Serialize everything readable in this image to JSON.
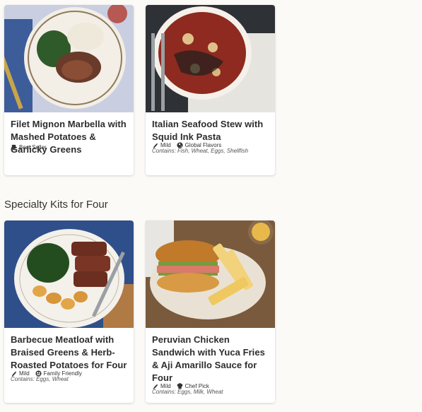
{
  "cards_top": [
    {
      "title": "Filet Mignon Marbella with Mashed Potatoes & Garlicky Greens",
      "contains": "",
      "tags": [
        {
          "icon": "badge-icon",
          "label": "Best Seller"
        }
      ]
    },
    {
      "title": "Italian Seafood Stew with Squid Ink Pasta",
      "contains": "Contains: Fish, Wheat, Eggs, Shellfish",
      "tags": [
        {
          "icon": "pepper-icon",
          "label": "Mild"
        },
        {
          "icon": "globe-icon",
          "label": "Global Flavors"
        }
      ]
    }
  ],
  "section": {
    "title": "Specialty Kits for Four"
  },
  "cards_bottom": [
    {
      "title": "Barbecue Meatloaf with Braised Greens & Herb-Roasted Potatoes for Four",
      "contains": "Contains: Eggs, Wheat",
      "tags": [
        {
          "icon": "pepper-icon",
          "label": "Mild"
        },
        {
          "icon": "family-icon",
          "label": "Family Friendly"
        }
      ]
    },
    {
      "title": "Peruvian Chicken Sandwich with Yuca Fries & Aji Amarillo Sauce for Four",
      "contains": "Contains: Eggs, Milk, Wheat",
      "tags": [
        {
          "icon": "pepper-icon",
          "label": "Mild"
        },
        {
          "icon": "chef-hat-icon",
          "label": "Chef Pick"
        }
      ]
    }
  ],
  "colors": {
    "background": "#fcfaf6",
    "card": "#ffffff",
    "text": "#2d2d2d"
  }
}
